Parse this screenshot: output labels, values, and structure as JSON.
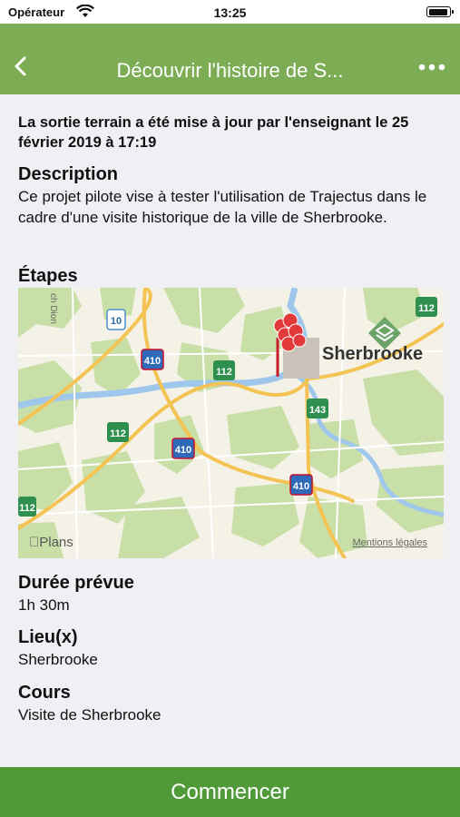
{
  "status_bar": {
    "carrier": "Opérateur",
    "time": "13:25",
    "battery_level": 0.95
  },
  "nav": {
    "title": "Découvrir l'histoire de S...",
    "back_icon": "chevron-left-icon",
    "more_icon": "more-horizontal-icon"
  },
  "update_note": "La sortie terrain a été mise à jour par l'enseignant le 25 février 2019 à 17:19",
  "description": {
    "label": "Description",
    "text": "Ce projet pilote vise à tester l'utilisation de Trajectus dans le cadre d'une visite historique de la ville de Sherbrooke."
  },
  "steps": {
    "label": "Étapes",
    "map": {
      "city_label": "Sherbrooke",
      "provider": "Plans",
      "legal": "Mentions légales",
      "road_labels": {
        "r10": "10",
        "r410a": "410",
        "r410b": "410",
        "r410c": "410",
        "r112a": "112",
        "r112b": "112",
        "r112c": "112",
        "r112d": "112",
        "r143": "143"
      },
      "partial_street": "ch Dion"
    }
  },
  "duration": {
    "label": "Durée prévue",
    "value": "1h 30m"
  },
  "location": {
    "label": "Lieu(x)",
    "value": "Sherbrooke"
  },
  "course": {
    "label": "Cours",
    "value": "Visite de Sherbrooke"
  },
  "start_button": "Commencer",
  "colors": {
    "nav": "#7cad55",
    "button": "#519a39",
    "background": "#efeff4"
  }
}
